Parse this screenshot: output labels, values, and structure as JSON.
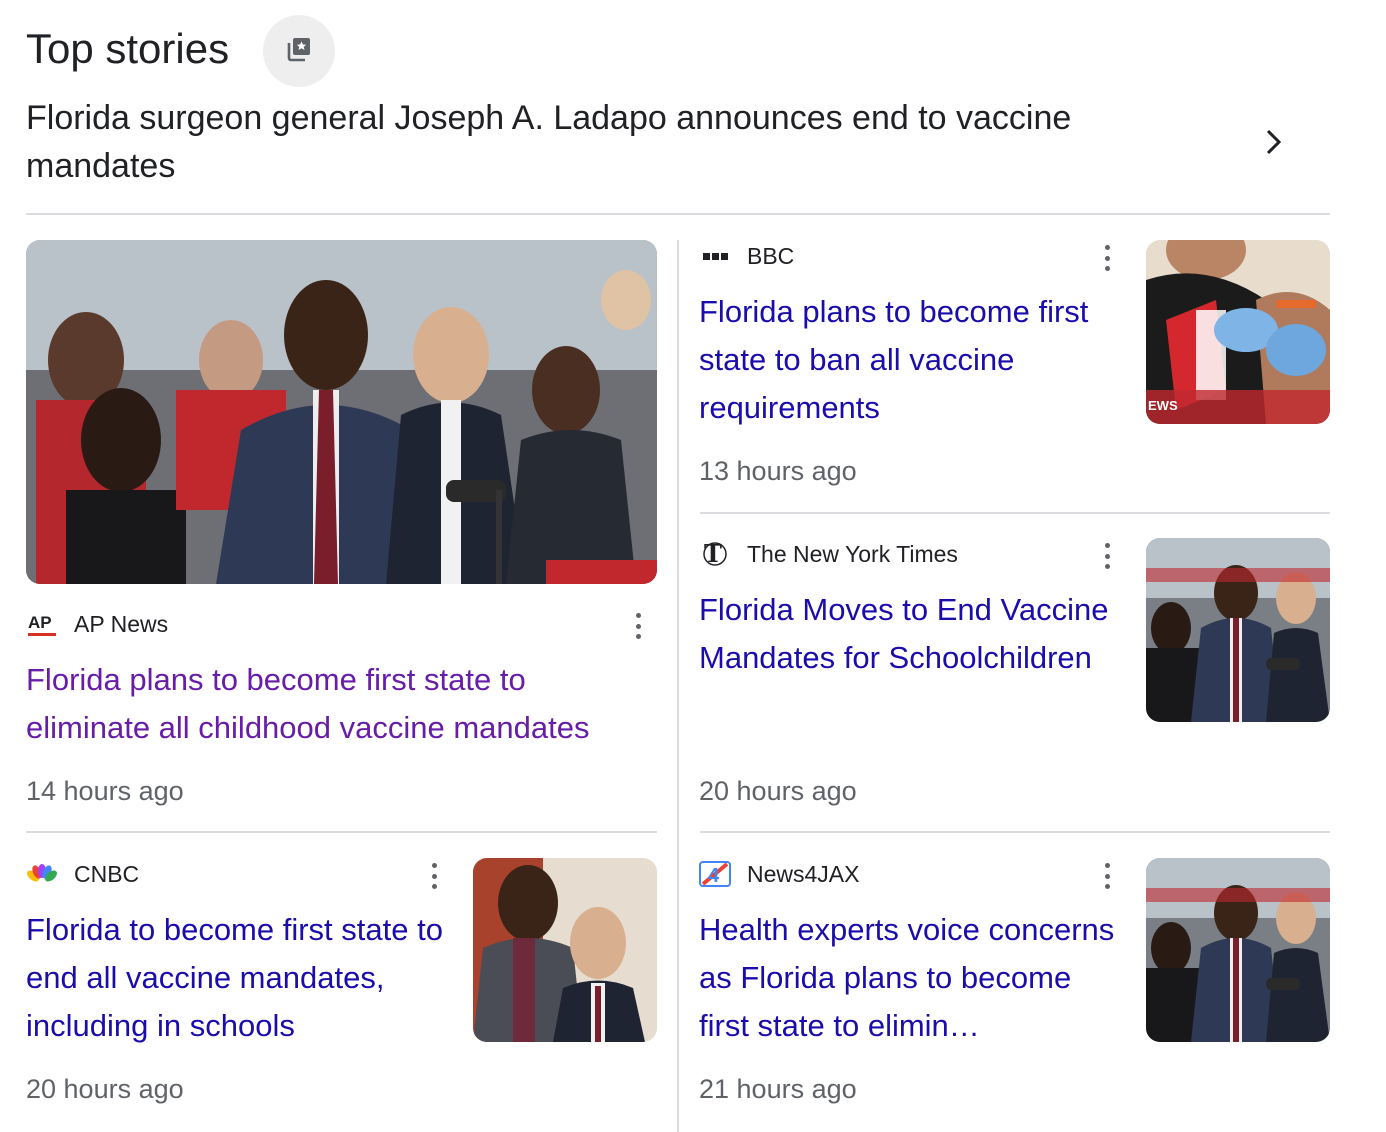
{
  "header": {
    "title": "Top stories",
    "icon": "stories-icon",
    "headline": "Florida surgeon general Joseph A. Ladapo announces end to vaccine mandates",
    "chevron_icon": "chevron-right-icon"
  },
  "colors": {
    "link": "#1a0dab",
    "visited_link": "#681da8",
    "meta": "#5f6368",
    "divider": "#dadce0"
  },
  "stories": [
    {
      "source": "AP News",
      "logo": "ap-news-logo",
      "title": "Florida plans to become first state to eliminate all childhood vaccine mandates",
      "time": "14 hours ago",
      "image": "press-conference-photo"
    },
    {
      "source": "BBC",
      "logo": "bbc-logo",
      "title": "Florida plans to become first state to ban all vaccine requirements",
      "time": "13 hours ago",
      "image": "vaccination-photo",
      "image_text": "EWS"
    },
    {
      "source": "The New York Times",
      "logo": "nyt-logo",
      "title": "Florida Moves to End Vaccine Mandates for Schoolchildren",
      "time": "20 hours ago",
      "image": "press-conference-photo"
    },
    {
      "source": "CNBC",
      "logo": "cnbc-peacock-logo",
      "title": "Florida to become first state to end all vaccine mandates, including in schools",
      "time": "20 hours ago",
      "image": "officials-photo"
    },
    {
      "source": "News4JAX",
      "logo": "news4jax-logo",
      "title": "Health experts voice concerns as Florida plans to become first state to elimin…",
      "time": "21 hours ago",
      "image": "press-conference-photo"
    }
  ]
}
